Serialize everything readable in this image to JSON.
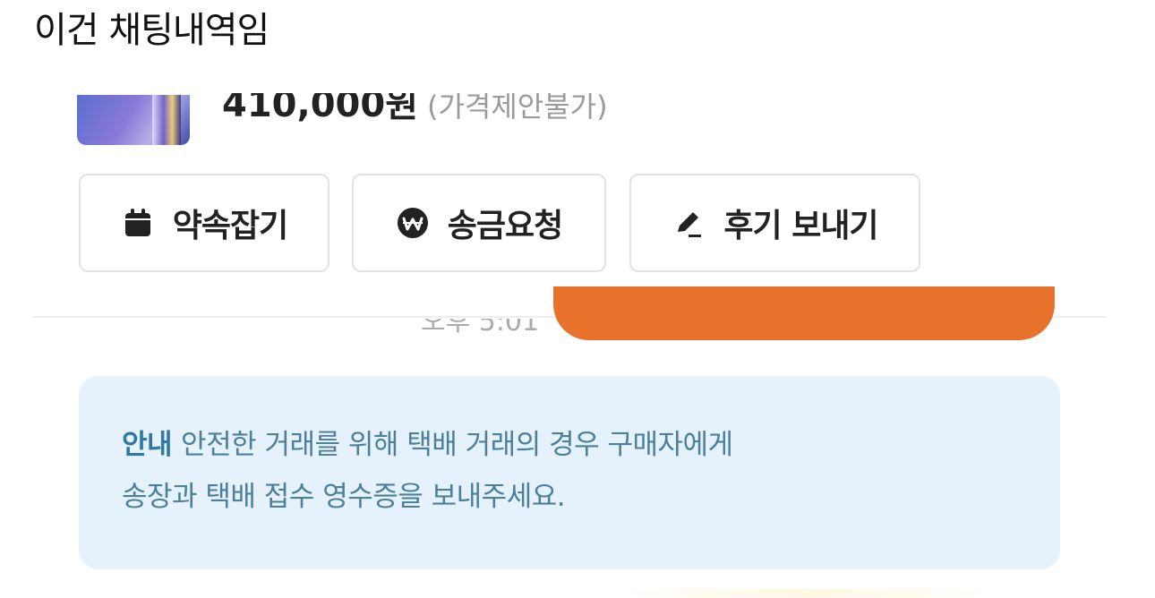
{
  "caption": "이건 채팅내역임",
  "product": {
    "price": "410,000원",
    "price_note": "(가격제안불가)"
  },
  "actions": [
    {
      "label": "약속잡기",
      "icon": "calendar-icon"
    },
    {
      "label": "송금요청",
      "icon": "won-coin-icon"
    },
    {
      "label": "후기 보내기",
      "icon": "pencil-icon"
    }
  ],
  "chat": {
    "time": "오후 5:01",
    "bubble_color": "#e8712c"
  },
  "notice": {
    "label": "안내",
    "line1": "안전한 거래를 위해 택배 거래의 경우 구매자에게",
    "line2": "송장과 택배 접수 영수증을 보내주세요."
  },
  "colors": {
    "accent_orange": "#e8712c",
    "notice_bg": "#e5f2fb",
    "notice_text": "#4b7f9a"
  }
}
